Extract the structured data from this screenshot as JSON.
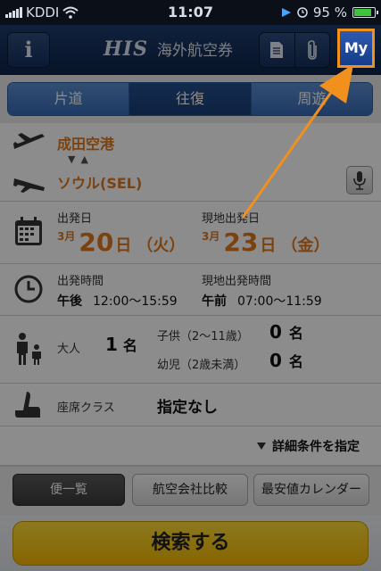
{
  "status_bar": {
    "carrier": "KDDI",
    "time": "11:07",
    "battery": "95 %",
    "battery_level": 0.95
  },
  "navbar": {
    "info_label": "i",
    "logo": "HIS",
    "title": "海外航空券",
    "my_label": "My"
  },
  "trip_types": {
    "options": [
      "片道",
      "往復",
      "周遊"
    ],
    "selected": "往復"
  },
  "route": {
    "departure": "成田空港",
    "arrival": "ソウル(SEL)"
  },
  "dates": {
    "departure": {
      "caption": "出発日",
      "month": "3月",
      "day": "20",
      "suffix": "日",
      "weekday": "（火）"
    },
    "return": {
      "caption": "現地出発日",
      "month": "3月",
      "day": "23",
      "suffix": "日",
      "weekday": "（金）"
    }
  },
  "times": {
    "departure": {
      "caption": "出発時間",
      "period": "午後",
      "range": "12:00〜15:59"
    },
    "return": {
      "caption": "現地出発時間",
      "period": "午前",
      "range": "07:00〜11:59"
    }
  },
  "passengers": {
    "adult_label": "大人",
    "adult_count": "1",
    "child_label": "子供（2〜11歳）",
    "child_count": "0",
    "infant_label": "幼児（2歳未満）",
    "infant_count": "0",
    "unit": "名"
  },
  "seat": {
    "label": "座席クラス",
    "value": "指定なし"
  },
  "detail_link": "詳細条件を指定",
  "result_tabs": {
    "list": "便一覧",
    "airline": "航空会社比較",
    "calendar": "最安値カレンダー"
  },
  "search_button": "検索する",
  "colors": {
    "accent_orange": "#e0781e",
    "nav_blue": "#1d3d6f",
    "highlight": "#f2901e",
    "search_yellow": "#ffd21a"
  },
  "icons": {
    "info": "info-icon",
    "document": "document-icon",
    "clip": "paperclip-icon",
    "plane_dep": "plane-departure-icon",
    "plane_arr": "plane-arrival-icon",
    "mic": "microphone-icon",
    "calendar": "calendar-icon",
    "clock": "clock-icon",
    "people": "people-icon",
    "seat": "seat-icon"
  }
}
